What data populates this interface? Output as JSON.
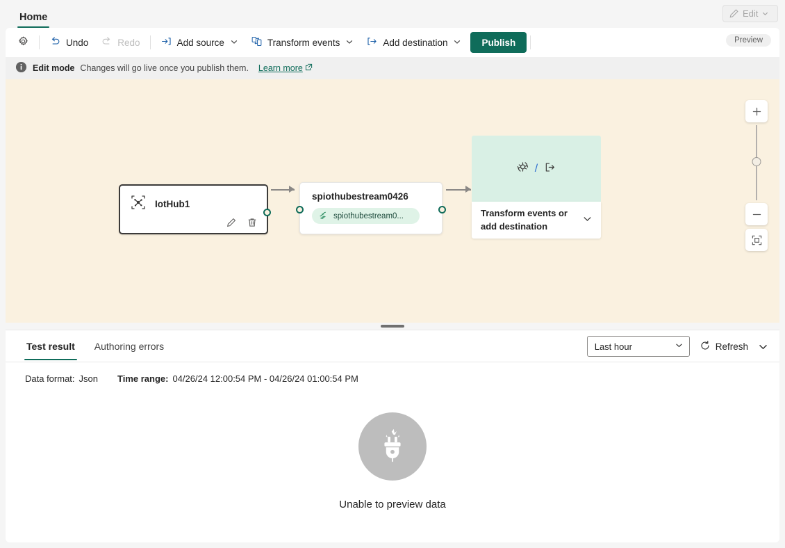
{
  "window": {
    "tab_label": "Home",
    "edit_button": {
      "label": "Edit",
      "icon": "pencil-icon"
    },
    "preview_badge": "Preview"
  },
  "toolbar": {
    "settings_icon": "gear-icon",
    "undo_label": "Undo",
    "redo_label": "Redo",
    "add_source_label": "Add source",
    "transform_events_label": "Transform events",
    "add_destination_label": "Add destination",
    "publish_label": "Publish"
  },
  "infobar": {
    "title": "Edit mode",
    "message": "Changes will go live once you publish them.",
    "link_label": "Learn more",
    "info_icon": "info-icon",
    "external_link_icon": "external-link-icon"
  },
  "canvas": {
    "source_node": {
      "title": "IotHub1",
      "icon": "iot-hub-icon",
      "edit_icon": "pencil-icon",
      "delete_icon": "trash-icon"
    },
    "stream_node": {
      "title": "spiothubestream0426",
      "pill_label": "spiothubestream0...",
      "pill_icon": "stream-icon"
    },
    "destination_node": {
      "label": "Transform events or add destination",
      "transform_icon": "transform-icon",
      "destination_icon": "destination-icon",
      "separator": "/",
      "chevron_icon": "chevron-down-icon"
    },
    "zoom_controls": {
      "zoom_in_label": "+",
      "zoom_out_label": "−",
      "fit_icon": "fit-to-screen-icon"
    },
    "background_color": "#faf1e0",
    "accent_color": "#0f6c5a"
  },
  "bottom_panel": {
    "tabs": [
      {
        "label": "Test result",
        "active": true
      },
      {
        "label": "Authoring errors",
        "active": false
      }
    ],
    "time_range_select": {
      "value": "Last hour"
    },
    "refresh_label": "Refresh",
    "refresh_icon": "refresh-icon",
    "more_icon": "chevron-down-icon",
    "meta": {
      "data_format_label": "Data format:",
      "data_format_value": "Json",
      "time_range_label": "Time range:",
      "time_range_value": "04/26/24 12:00:54 PM  -  04/26/24 01:00:54 PM"
    },
    "empty_state": {
      "text": "Unable to preview data",
      "icon": "unplugged-icon"
    }
  }
}
